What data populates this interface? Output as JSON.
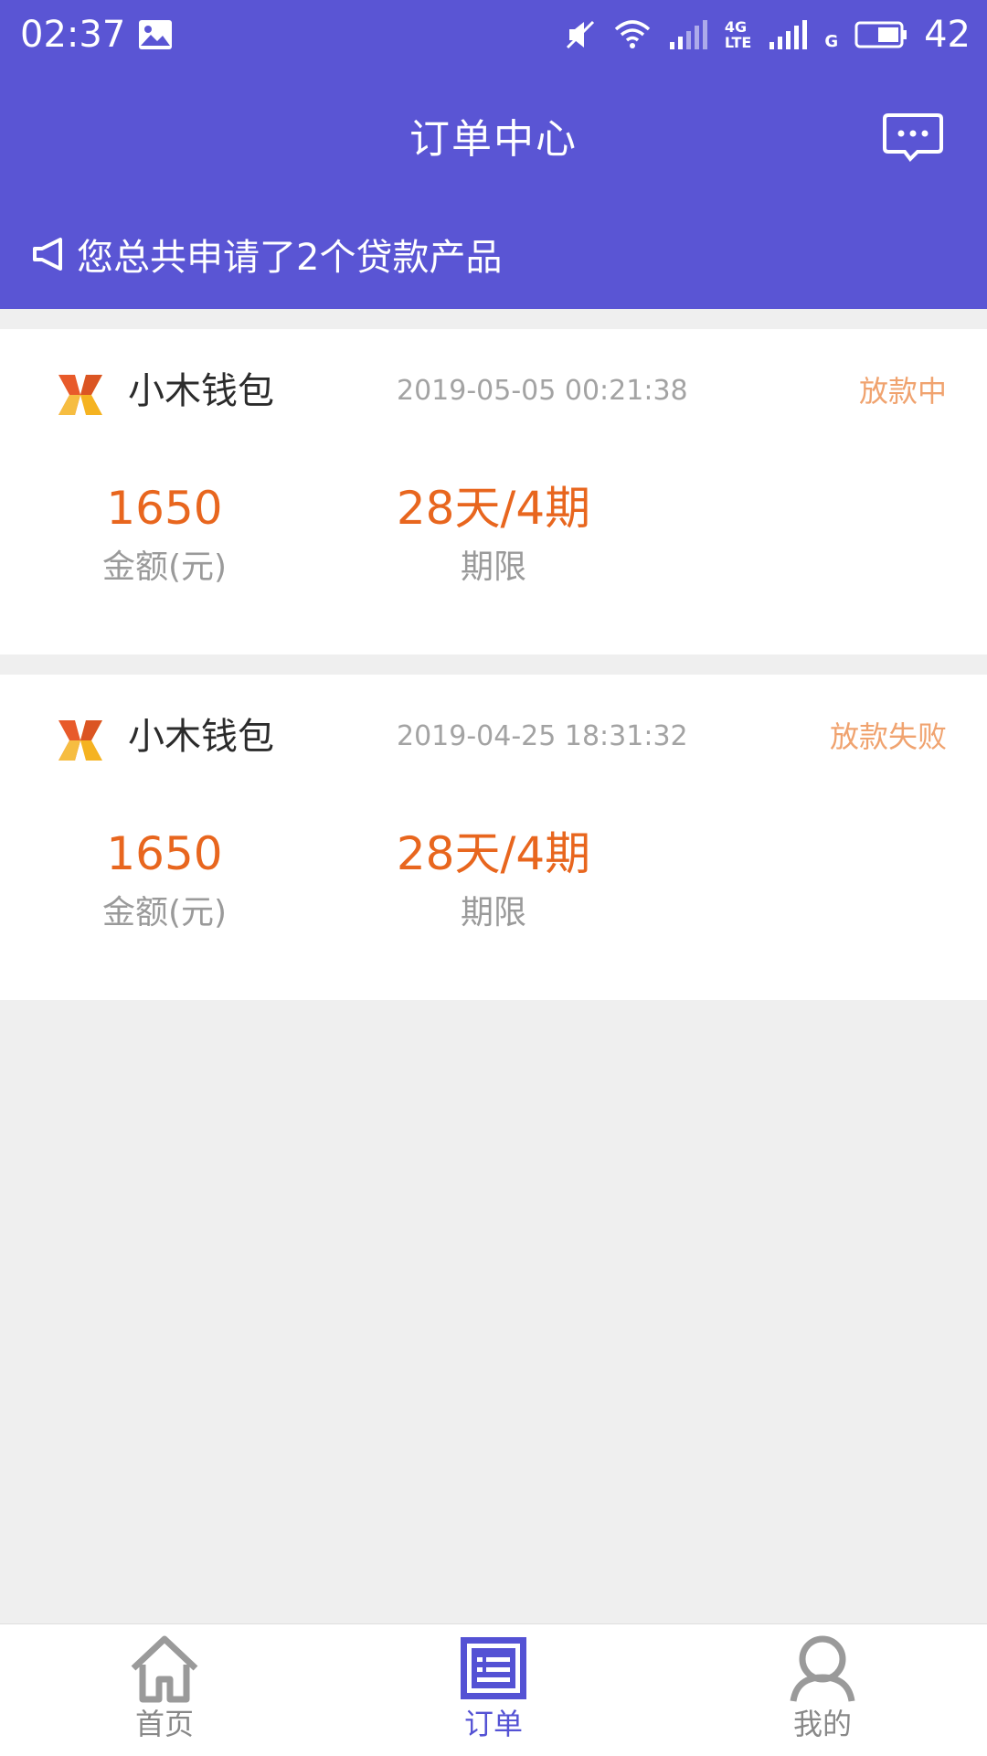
{
  "status_bar": {
    "time": "02:37",
    "network_label_1": "4G",
    "network_label_2": "LTE",
    "network_label_3": "G",
    "battery": "42"
  },
  "header": {
    "title": "订单中心",
    "notice": "您总共申请了2个贷款产品"
  },
  "orders": [
    {
      "brand": "小木钱包",
      "time": "2019-05-05 00:21:38",
      "status": "放款中",
      "amount": "1650",
      "amount_label": "金额(元)",
      "term": "28天/4期",
      "term_label": "期限"
    },
    {
      "brand": "小木钱包",
      "time": "2019-04-25 18:31:32",
      "status": "放款失败",
      "amount": "1650",
      "amount_label": "金额(元)",
      "term": "28天/4期",
      "term_label": "期限"
    }
  ],
  "tabs": [
    {
      "label": "首页",
      "icon": "home-icon",
      "active": false
    },
    {
      "label": "订单",
      "icon": "order-icon",
      "active": true
    },
    {
      "label": "我的",
      "icon": "user-icon",
      "active": false
    }
  ],
  "colors": {
    "header_bg": "#5a55d4",
    "accent": "#e8661e",
    "status_text": "#f0a36f",
    "tab_active": "#5452d4"
  }
}
